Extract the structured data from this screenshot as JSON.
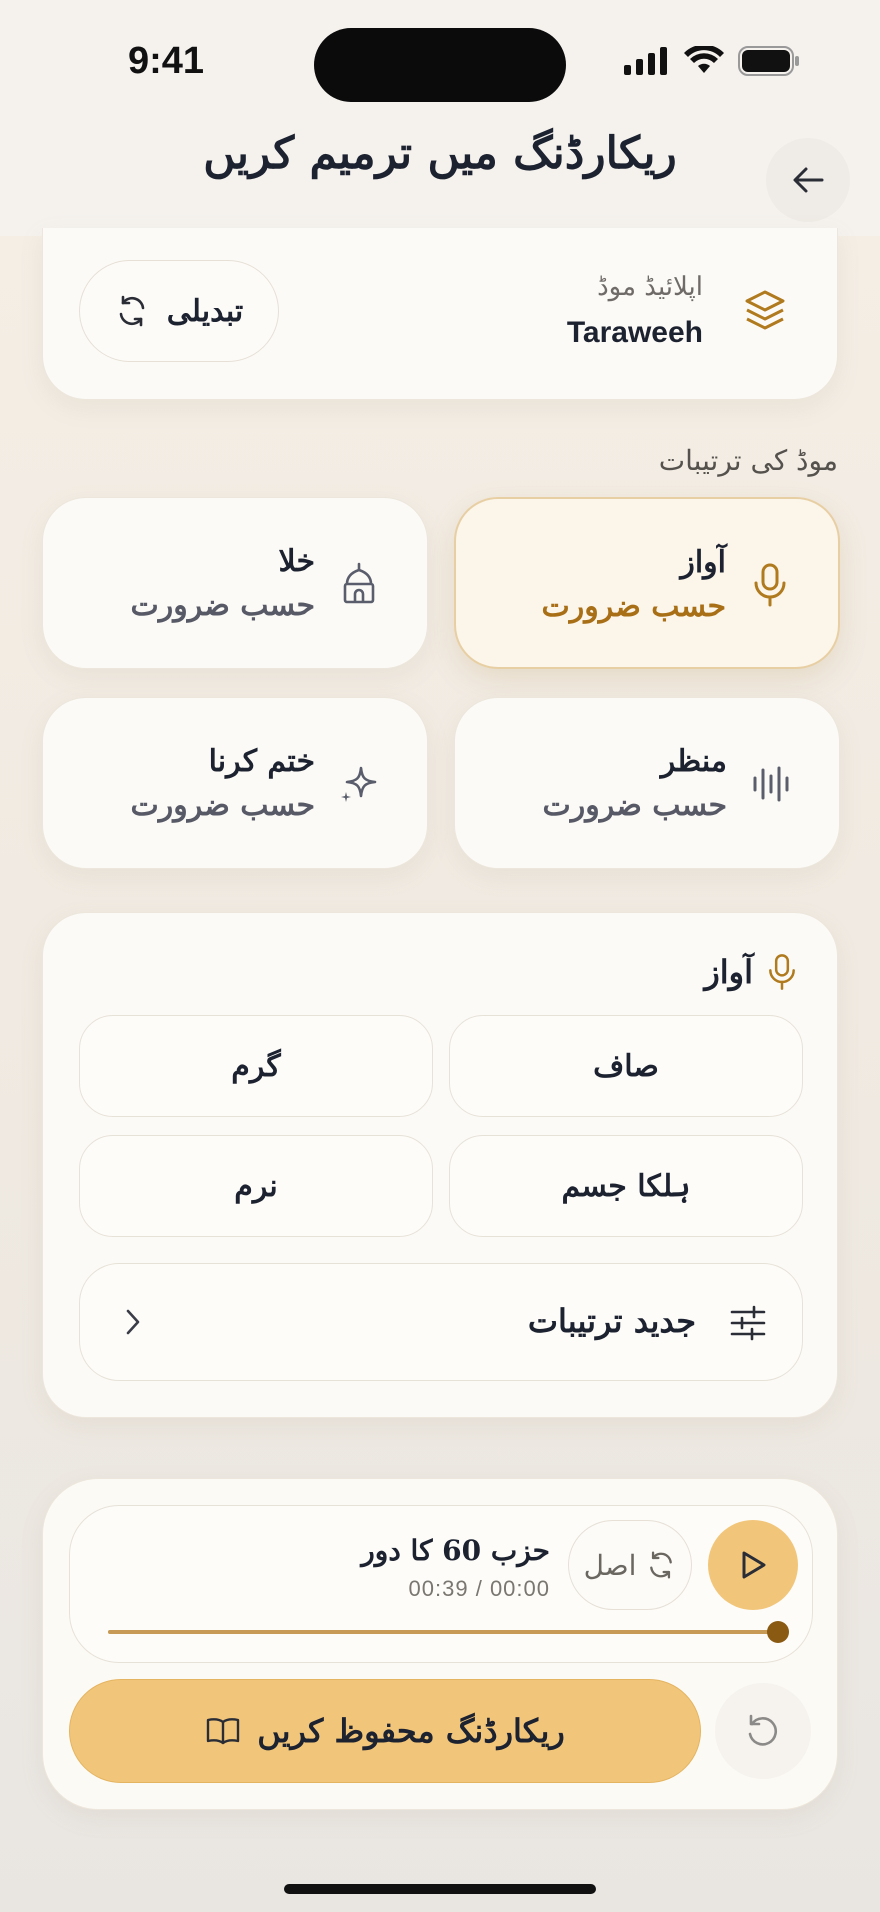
{
  "status_bar": {
    "time": "9:41"
  },
  "header": {
    "title": "ریکارڈنگ میں ترمیم کریں",
    "back_icon": "arrow-left-icon"
  },
  "applied_mode": {
    "label": "اپلائیڈ موڈ",
    "value": "Taraweeh",
    "change_label": "تبدیلی",
    "icon": "layers-icon",
    "accent": "#b07a1e"
  },
  "mode_settings": {
    "title": "موڈ کی ترتیبات",
    "cards": [
      {
        "name": "آواز",
        "value": "حسب ضرورت",
        "icon": "mic-icon",
        "active": true
      },
      {
        "name": "خلا",
        "value": "حسب ضرورت",
        "icon": "mosque-icon",
        "active": false
      },
      {
        "name": "منظر",
        "value": "حسب ضرورت",
        "icon": "waveform-icon",
        "active": false
      },
      {
        "name": "ختم کرنا",
        "value": "حسب ضرورت",
        "icon": "sparkle-icon",
        "active": false
      }
    ]
  },
  "voice_panel": {
    "title": "آواز",
    "options": [
      "صاف",
      "گرم",
      "ہلکا جسم",
      "نرم"
    ],
    "advanced_label": "جدید ترتیبات"
  },
  "player": {
    "track_title": "حزب 60 کا دور",
    "time": "00:39 / 00:00",
    "original_label": "اصل",
    "progress": 1.0,
    "save_label": "ریکارڈنگ محفوظ کریں"
  },
  "colors": {
    "accent": "#f2c67a",
    "accent_dark": "#a86f17",
    "background": "#f5efe6"
  }
}
